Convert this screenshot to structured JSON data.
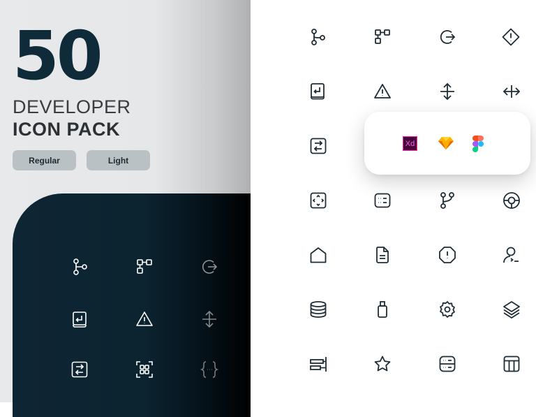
{
  "hero": {
    "count": "50",
    "line1": "DEVELOPER",
    "line2": "ICON PACK"
  },
  "styles": {
    "regular_label": "Regular",
    "light_label": "Light"
  },
  "colors": {
    "navy": "#0f2a38",
    "chip_bg": "#b9c1c5",
    "icon_stroke": "#1f2d36",
    "dark_icon_stroke": "#ffffff",
    "xd_bg": "#470137",
    "xd_text": "#ff61f6",
    "sketch_fill": "#fdb300"
  },
  "tools": {
    "xd_label": "Xd",
    "items": [
      "adobe-xd",
      "sketch",
      "figma"
    ]
  },
  "dark_preview_icons": [
    "git-commit-branch",
    "flow-diagram",
    "logout",
    "book-return",
    "warning-triangle",
    "vertical-resize",
    "swap-arrows",
    "qr-scan",
    "code-braces"
  ],
  "grid_icons": [
    "git-commit-branch",
    "flow-diagram",
    "logout",
    "diamond-alert",
    "book-return",
    "warning-triangle",
    "vertical-resize",
    "horizontal-resize",
    "swap-arrows",
    "frame-expand",
    "list-panel",
    "git-merge",
    "lifebuoy",
    "home",
    "document",
    "octagon-alert",
    "user-terminal",
    "database",
    "usb-drive",
    "settings-gear",
    "layers",
    "align-right-bars",
    "star",
    "server",
    "layout-table"
  ]
}
